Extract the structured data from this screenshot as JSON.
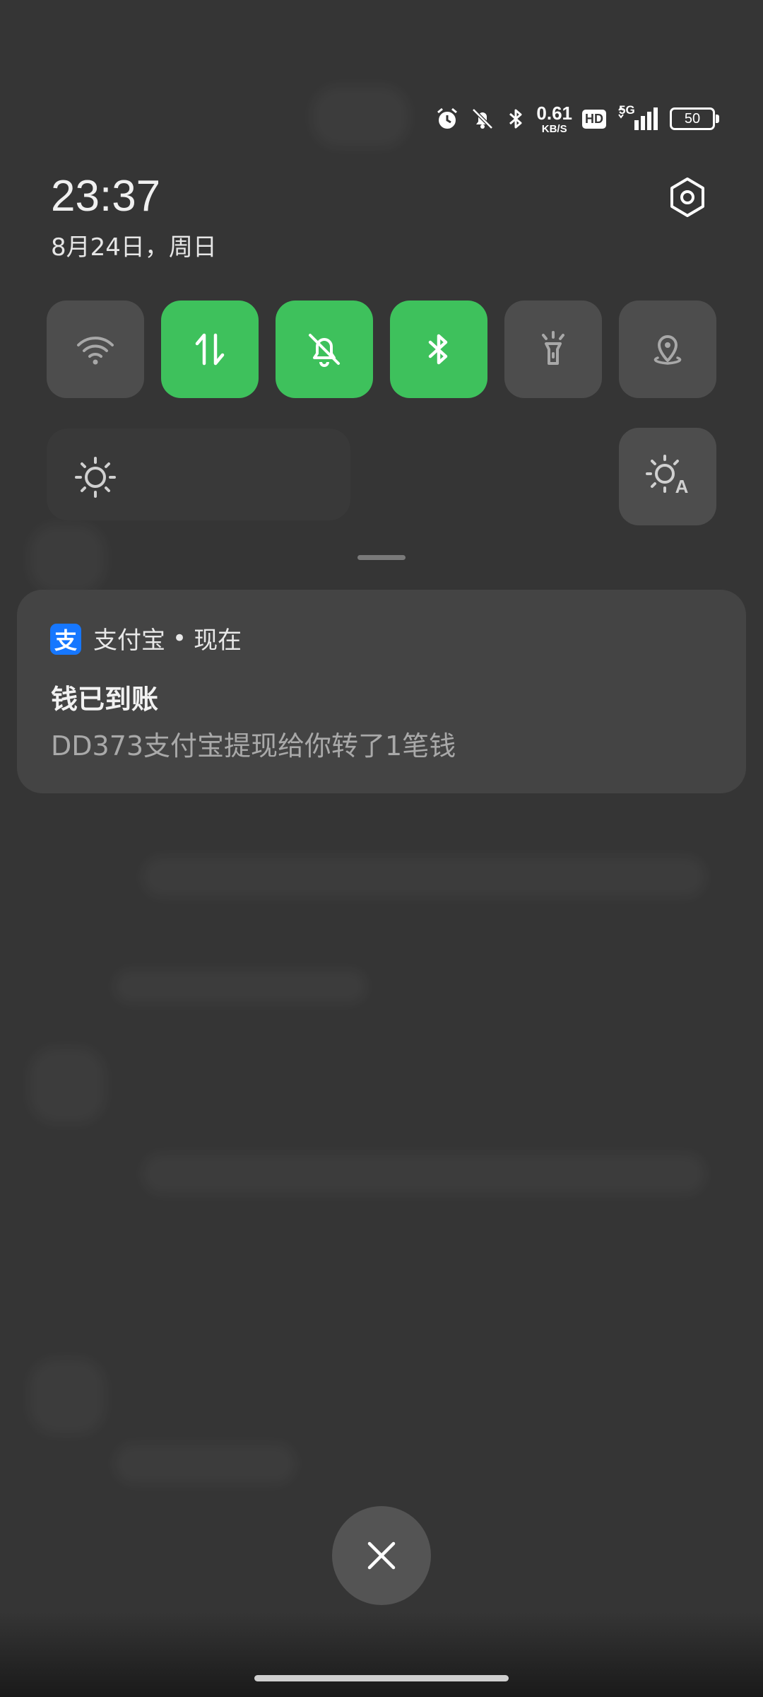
{
  "status_bar": {
    "icons": [
      "alarm-icon",
      "bell-off-icon",
      "bluetooth-icon",
      "hd-icon",
      "signal-icon",
      "battery-icon"
    ],
    "net_speed_value": "0.61",
    "net_speed_unit": "KB/S",
    "hd_label": "HD",
    "network_type": "5G",
    "battery_level": "50"
  },
  "header": {
    "time": "23:37",
    "date": "8月24日，周日",
    "settings_icon": "gear-icon"
  },
  "quick_tiles": [
    {
      "name": "wifi",
      "icon": "wifi-icon",
      "active": false
    },
    {
      "name": "mobile-data",
      "icon": "data-arrows-icon",
      "active": true
    },
    {
      "name": "silent",
      "icon": "bell-off-icon",
      "active": true
    },
    {
      "name": "bluetooth",
      "icon": "bluetooth-icon",
      "active": true
    },
    {
      "name": "flashlight",
      "icon": "flashlight-icon",
      "active": false
    },
    {
      "name": "location",
      "icon": "location-icon",
      "active": false
    }
  ],
  "brightness": {
    "icon": "sun-icon",
    "auto_icon": "auto-brightness-icon",
    "auto_label": "A"
  },
  "notification": {
    "app_icon_char": "支",
    "app_name": "支付宝",
    "separator": "•",
    "time": "现在",
    "title": "钱已到账",
    "body": "DD373支付宝提现给你转了1笔钱"
  },
  "colors": {
    "background": "#353535",
    "tile_active": "#3ec15c",
    "tile_inactive": "#4d4d4d",
    "alipay_blue": "#1677ff"
  }
}
